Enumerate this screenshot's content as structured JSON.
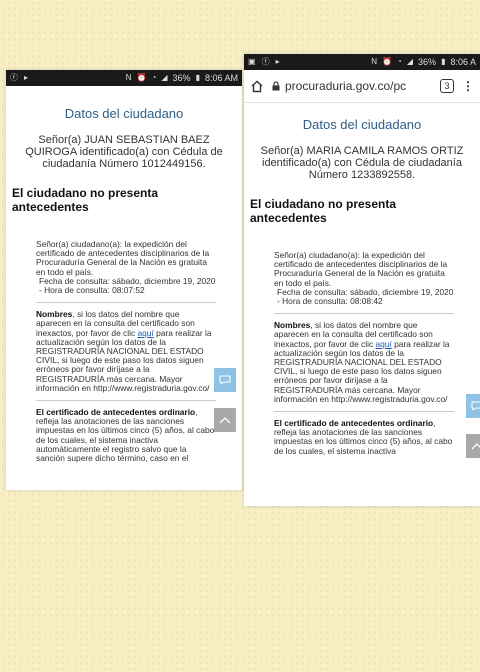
{
  "left_screen": {
    "status": {
      "battery": "36%",
      "time": "8:06 AM"
    },
    "title": "Datos del ciudadano",
    "intro": "Señor(a)  JUAN SEBASTIAN BAEZ QUIROGA identificado(a) con Cédula de ciudadanía Número 1012449156.",
    "heading": "El ciudadano no presenta antecedentes",
    "para1": "Señor(a) ciudadano(a): la expedición del certificado de antecedentes disciplinarios de la Procuraduría General de la Nación es gratuita en todo el país.",
    "consult": "Fecha de consulta: sábado, diciembre 19, 2020 - Hora de consulta: 08:07:52",
    "names_bold": "Nombres",
    "names_pre": ", si los datos del nombre que aparecen en la consulta del certificado son inexactos, por favor de clic ",
    "link": "aquí",
    "names_post": " para realizar la actualización según los datos de la REGISTRADURÍA NACIONAL DEL ESTADO CIVIL, si luego de este paso los datos siguen erróneos por favor diríjase a la REGISTRADURÍA más cercana. Mayor información en http://www.registraduria.gov.co/",
    "cert_bold": "El certificado de antecedentes ordinario",
    "cert_text": ", refleja las anotaciones de las sanciones impuestas en los últimos cinco (5) años, al cabo de los cuales, el sistema inactiva automáticamente el registro salvo que la sanción supere dicho término, caso en el"
  },
  "right_screen": {
    "status": {
      "battery": "36%",
      "time": "8:06 A"
    },
    "url": "procuraduria.gov.co/pc",
    "tab_count": "3",
    "title": "Datos del ciudadano",
    "intro": "Señor(a)  MARIA CAMILA RAMOS ORTIZ identificado(a) con Cédula de ciudadanía Número 1233892558.",
    "heading": "El ciudadano no presenta antecedentes",
    "para1": "Señor(a) ciudadano(a): la expedición del certificado de antecedentes disciplinarios de la Procuraduría General de la Nación es gratuita en todo el país.",
    "consult": "Fecha de consulta: sábado, diciembre 19, 2020 - Hora de consulta: 08:08:42",
    "names_bold": "Nombres",
    "names_pre": ", si los datos del nombre que aparecen en la consulta del certificado son inexactos, por favor de clic ",
    "link": "aquí",
    "names_post": " para realizar la actualización según los datos de la REGISTRADURÍA NACIONAL DEL ESTADO CIVIL, si luego de este paso los datos siguen erróneos por favor diríjase a la REGISTRADURÍA más cercana. Mayor información en http://www.registraduria.gov.co/",
    "cert_bold": "El certificado de antecedentes ordinario",
    "cert_text": ", refleja las anotaciones de las sanciones impuestas en los últimos cinco (5) años, al cabo de los cuales, el sistema inactiva"
  }
}
